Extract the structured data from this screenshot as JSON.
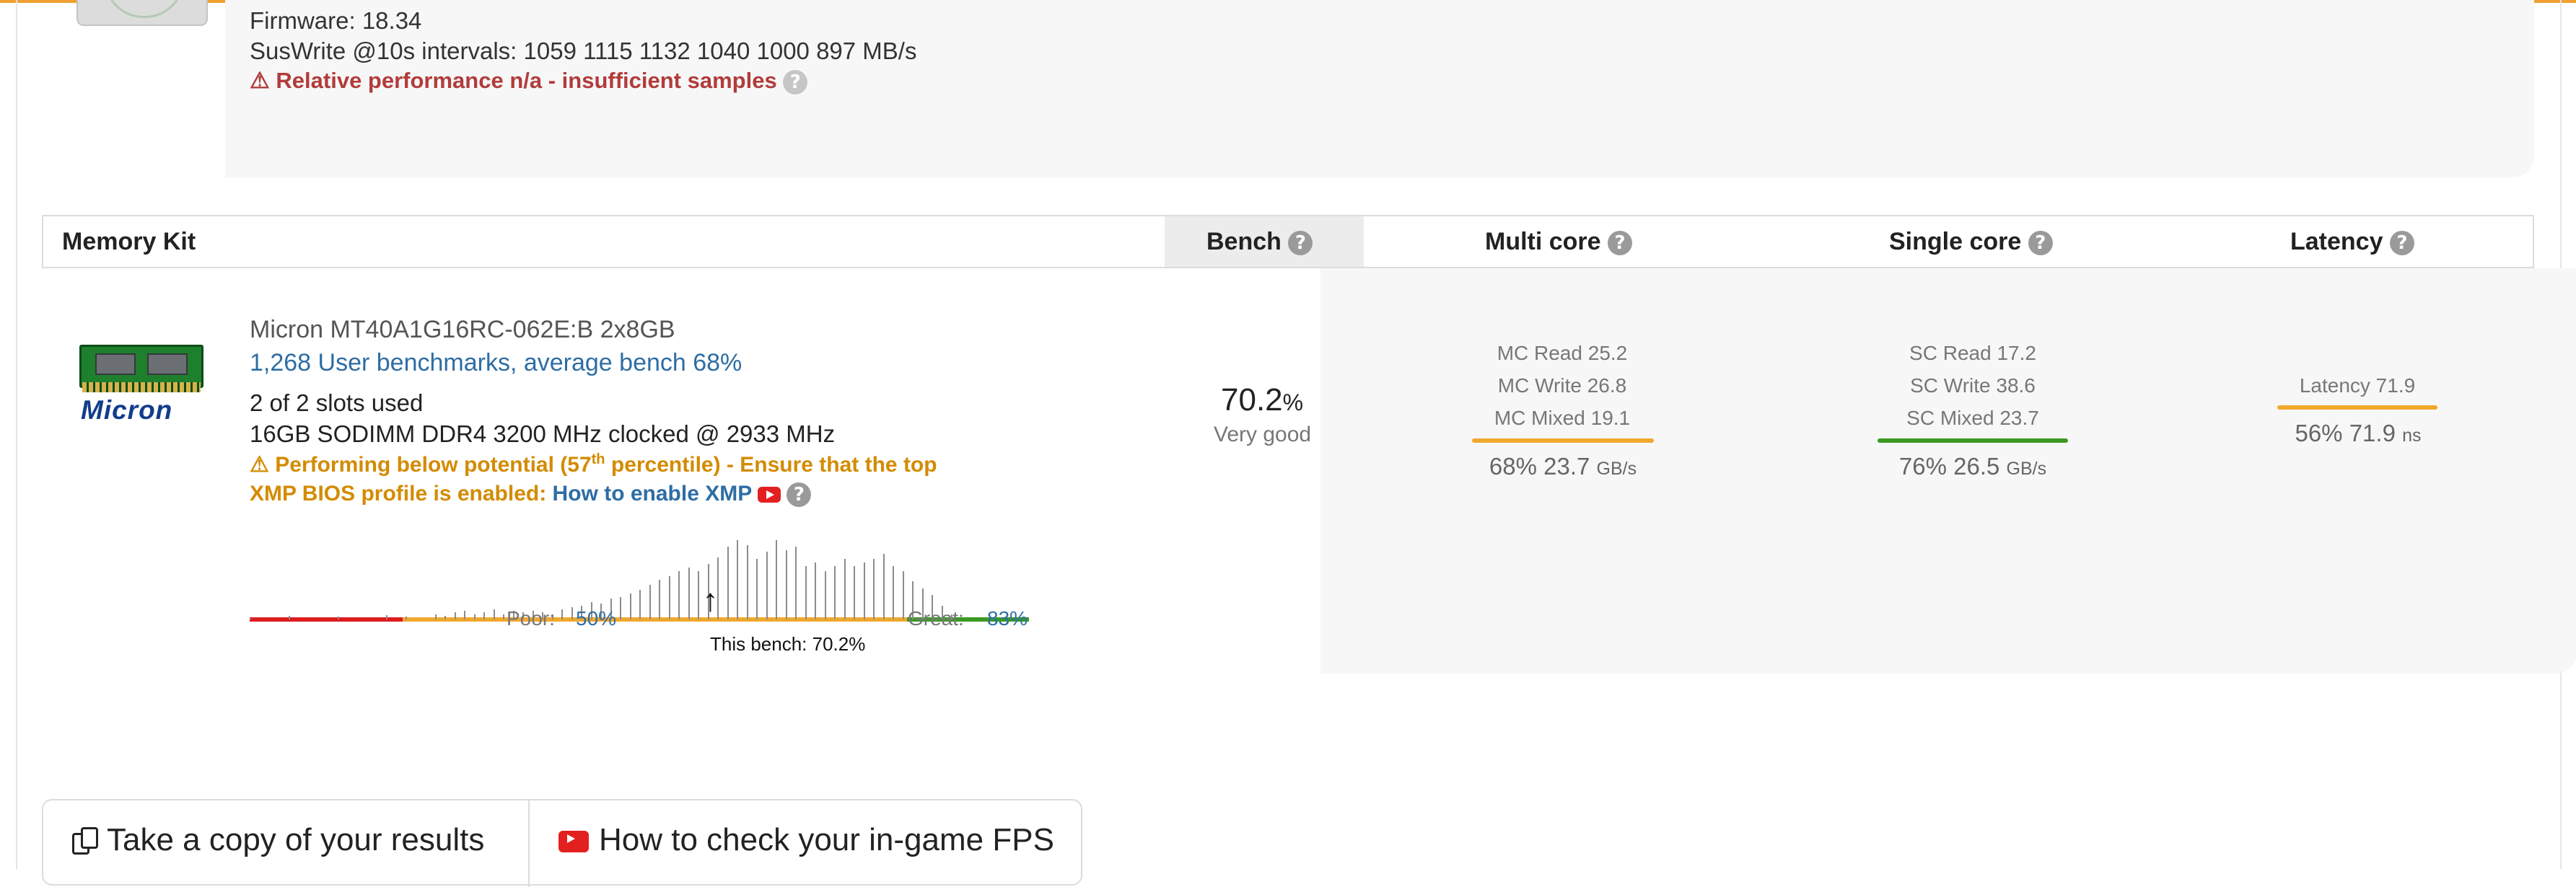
{
  "previous_item": {
    "firmware": "Firmware: 18.34",
    "suswrite": "SusWrite @10s intervals: 1059 1115 1132 1040 1000 897 MB/s",
    "warning": "Relative performance n/a - insufficient samples"
  },
  "table": {
    "headers": {
      "memory_kit": "Memory Kit",
      "bench": "Bench",
      "multi_core": "Multi core",
      "single_core": "Single core",
      "latency": "Latency"
    }
  },
  "memory": {
    "logo_text": "Micron",
    "name": "Micron MT40A1G16RC-062E:B 2x8GB",
    "benchmarks_link": "1,268 User benchmarks, average bench 68%",
    "slots": "2 of 2 slots used",
    "spec": "16GB SODIMM DDR4 3200 MHz clocked @ 2933 MHz",
    "warning_prefix": "Performing below potential (57",
    "warning_sup": "th",
    "warning_suffix": " percentile) - Ensure that the top",
    "warning_line2": "XMP BIOS profile is enabled:",
    "xmp_link": "How to enable XMP",
    "distribution": {
      "poor_label": "Poor:",
      "poor_value": "50%",
      "great_label": "Great:",
      "great_value": "83%",
      "this_bench": "This bench: 70.2%",
      "this_bench_pct": 70.2,
      "scale_min": 40,
      "scale_max": 91,
      "bars": [
        0.02,
        0.0,
        0.0,
        0.0,
        0.04,
        0.0,
        0.0,
        0.0,
        0.0,
        0.03,
        0.0,
        0.0,
        0.0,
        0.0,
        0.05,
        0.0,
        0.03,
        0.0,
        0.0,
        0.06,
        0.04,
        0.08,
        0.1,
        0.06,
        0.08,
        0.12,
        0.06,
        0.1,
        0.08,
        0.1,
        0.08,
        0.06,
        0.12,
        0.14,
        0.16,
        0.2,
        0.18,
        0.24,
        0.26,
        0.3,
        0.34,
        0.4,
        0.46,
        0.5,
        0.56,
        0.6,
        0.56,
        0.64,
        0.72,
        0.84,
        0.92,
        0.86,
        0.7,
        0.78,
        0.92,
        0.8,
        0.84,
        0.62,
        0.66,
        0.56,
        0.62,
        0.7,
        0.62,
        0.66,
        0.7,
        0.76,
        0.62,
        0.56,
        0.44,
        0.36,
        0.28,
        0.16,
        0.06
      ],
      "colors": {
        "poor": "#dd1d1d",
        "average": "#f1a82e",
        "great": "#3a9a22"
      }
    },
    "bench": {
      "value": "70.2",
      "unit": "%",
      "rating": "Very good"
    },
    "multi_core": {
      "lines": [
        "MC Read 25.2",
        "MC Write 26.8",
        "MC Mixed 19.1"
      ],
      "summary_pct": "68%",
      "summary_value": "23.7",
      "unit": "GB/s",
      "bar_color": "#f1a82e"
    },
    "single_core": {
      "lines": [
        "SC Read 17.2",
        "SC Write 38.6",
        "SC Mixed 23.7"
      ],
      "summary_pct": "76%",
      "summary_value": "26.5",
      "unit": "GB/s",
      "bar_color": "#3a9a22"
    },
    "latency": {
      "line": "Latency 71.9",
      "summary_pct": "56%",
      "summary_value": "71.9",
      "unit": "ns",
      "bar_color": "#f1a82e"
    }
  },
  "buttons": {
    "copy_results": "Take a copy of your results",
    "check_fps": "How to check your in-game FPS"
  },
  "icons": {
    "help": "?",
    "warning": "⚠"
  },
  "colors": {
    "accent_orange": "#f0a030",
    "link_blue": "#2e6da4",
    "warning_red": "#b23b3b",
    "warning_orange": "#d38b00"
  }
}
